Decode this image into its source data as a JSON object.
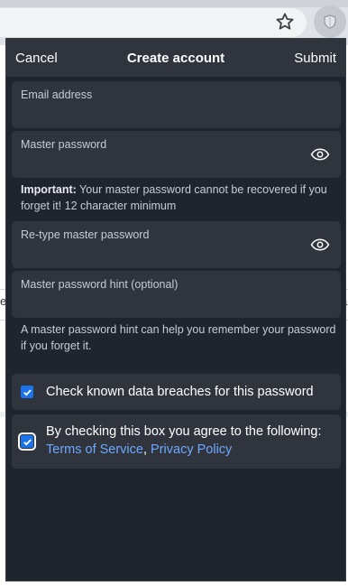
{
  "header": {
    "cancel_label": "Cancel",
    "title": "Create account",
    "submit_label": "Submit"
  },
  "fields": {
    "email_label": "Email address",
    "master_password_label": "Master password",
    "retype_label": "Re-type master password",
    "hint_label": "Master password hint (optional)"
  },
  "notes": {
    "important_label": "Important:",
    "important_text": " Your master password cannot be recovered if you forget it! 12 character minimum",
    "hint_text": "A master password hint can help you remember your password if you forget it."
  },
  "checks": {
    "breaches_label": "Check known data breaches for this password",
    "agree_label": "By checking this box you agree to the following:",
    "terms_label": "Terms of Service",
    "separator": ",",
    "privacy_label": "Privacy Policy"
  },
  "background": {
    "left_fragment": "el",
    "right_fragment": "a"
  },
  "colors": {
    "popup_bg": "#1f242e",
    "field_bg": "#2f343d",
    "checkbox": "#1a73e8",
    "link": "#6ea8fe"
  },
  "icons": {
    "star": "star-icon",
    "extension": "shield-icon",
    "eye": "eye-icon",
    "check": "check-icon"
  }
}
